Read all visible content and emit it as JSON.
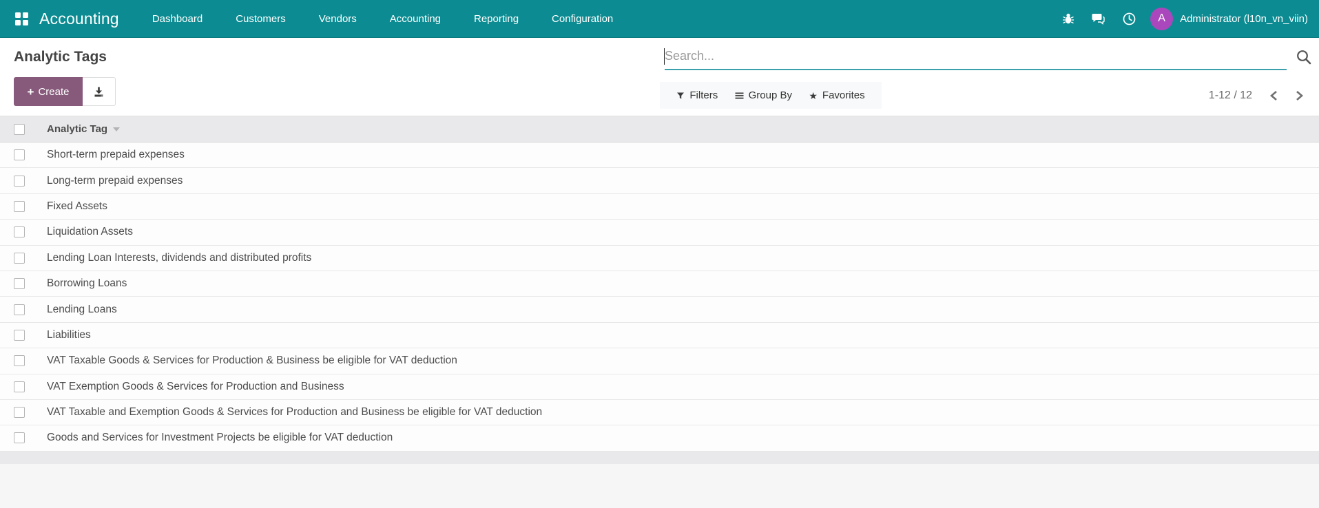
{
  "navbar": {
    "brand": "Accounting",
    "menu": [
      "Dashboard",
      "Customers",
      "Vendors",
      "Accounting",
      "Reporting",
      "Configuration"
    ],
    "user": "Administrator (l10n_vn_viin)",
    "avatar_initial": "A",
    "icons": {
      "apps": "apps-grid-icon",
      "debug": "bug-icon",
      "messages": "chat-icon",
      "activities": "clock-icon"
    }
  },
  "control_panel": {
    "title": "Analytic Tags",
    "create_label": "Create",
    "export_icon": "download-icon",
    "search_placeholder": "Search...",
    "search_value": "",
    "filters_label": "Filters",
    "group_by_label": "Group By",
    "favorites_label": "Favorites",
    "favorites_icon": "★",
    "pager_value": "1-12 / 12"
  },
  "table": {
    "column_header": "Analytic Tag",
    "rows": [
      "Short-term prepaid expenses",
      "Long-term prepaid expenses",
      "Fixed Assets",
      "Liquidation Assets",
      "Lending Loan Interests, dividends and distributed profits",
      "Borrowing Loans",
      "Lending Loans",
      "Liabilities",
      "VAT Taxable Goods & Services for Production & Business be eligible for VAT deduction",
      "VAT Exemption Goods & Services for Production and Business",
      "VAT Taxable and Exemption Goods & Services for Production and Business be eligible for VAT deduction",
      "Goods and Services for Investment Projects be eligible for VAT deduction"
    ]
  },
  "colors": {
    "navbar_bg": "#0c8c92",
    "primary_button": "#875a7b",
    "avatar_bg": "#ab47bc",
    "search_underline": "#3aa0ac",
    "table_header_bg": "#e9e9eb"
  }
}
